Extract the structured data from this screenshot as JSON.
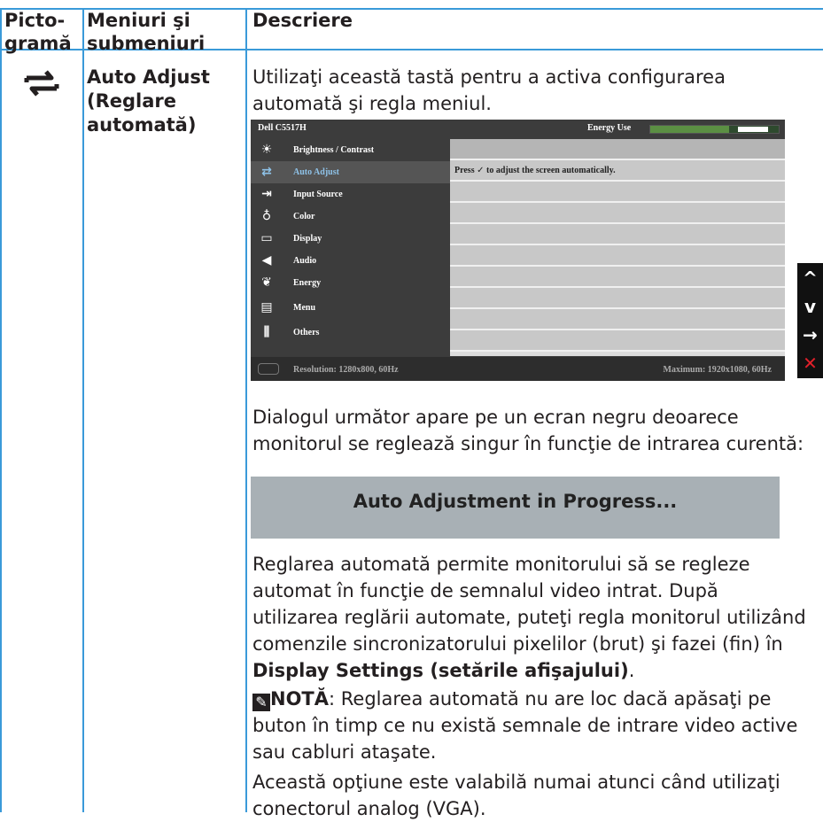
{
  "table": {
    "header": {
      "col1": [
        "Picto-",
        "gramă"
      ],
      "col2": [
        "Meniuri şi",
        "submeniuri"
      ],
      "col3": "Descriere"
    },
    "row_icon": "auto-adjust-icon",
    "row_menu": [
      "Auto Adjust",
      "(Reglare",
      "automată)"
    ]
  },
  "intro": [
    "Utilizaţi această tastă pentru a activa configurarea",
    "automată şi regla meniul."
  ],
  "osd": {
    "model": "Dell C5517H",
    "energy_label": "Energy Use",
    "energy_level": 0.72,
    "items": [
      {
        "label": "Brightness / Contrast",
        "icon": "brightness-icon",
        "glyph": "☀"
      },
      {
        "label": "Auto Adjust",
        "icon": "auto-adjust-icon",
        "glyph": "⇄"
      },
      {
        "label": "Input Source",
        "icon": "input-source-icon",
        "glyph": "⇥"
      },
      {
        "label": "Color",
        "icon": "color-icon",
        "glyph": "♁"
      },
      {
        "label": "Display",
        "icon": "display-icon",
        "glyph": "▭"
      },
      {
        "label": "Audio",
        "icon": "audio-icon",
        "glyph": "◀"
      },
      {
        "label": "Energy",
        "icon": "energy-icon",
        "glyph": "❦"
      },
      {
        "label": "Menu",
        "icon": "menu-icon",
        "glyph": "▤"
      },
      {
        "label": "Others",
        "icon": "others-icon",
        "glyph": "⫼"
      }
    ],
    "selected_index": 1,
    "panel_text_pre": "Press",
    "panel_text_post": "to adjust the screen automatically.",
    "resolution": "Resolution: 1280x800, 60Hz",
    "maximum": "Maximum: 1920x1080, 60Hz",
    "side_buttons": [
      "up-icon",
      "down-icon",
      "enter-icon",
      "close-icon"
    ]
  },
  "dialog_intro": [
    "Dialogul următor apare pe un ecran negru deoarece",
    "monitorul se reglează singur în funcţie de intrarea curentă:"
  ],
  "progress_text": "Auto Adjustment in Progress...",
  "para2": [
    "Reglarea automată permite monitorului să se regleze",
    "automat în funcţie de semnalul video intrat. După",
    "utilizarea reglării automate, puteţi regla monitorul utilizând",
    "comenzile sincronizatorului pixelilor (brut) şi fazei (fin) în"
  ],
  "para2_bold": "Display Settings (setările afişajului)",
  "para2_end": ".",
  "note_label": "NOTĂ",
  "note_lines": [
    ": Reglarea automată nu are loc dacă apăsaţi pe",
    "buton în timp ce nu există semnale de intrare video active",
    "sau cabluri ataşate."
  ],
  "para3": [
    "Această opţiune este valabilă numai atunci când utilizaţi",
    "conectorul analog (VGA)."
  ]
}
